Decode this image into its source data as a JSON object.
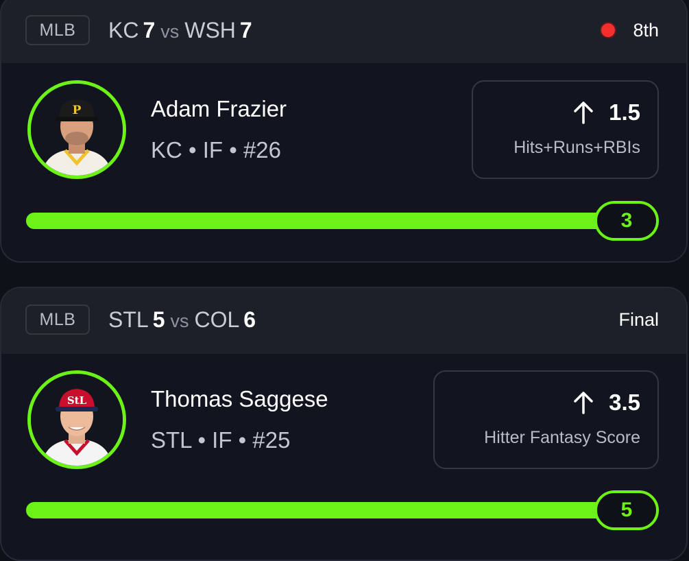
{
  "cards": [
    {
      "league": "MLB",
      "away_team": "KC",
      "away_score": "7",
      "vs": "vs",
      "home_team": "WSH",
      "home_score": "7",
      "status": "8th",
      "status_live": true,
      "player": {
        "name": "Adam Frazier",
        "meta": "KC • IF • #26",
        "avatar_icon": "player-headshot-pirates-cap"
      },
      "line": {
        "direction_icon": "arrow-up-icon",
        "value": "1.5",
        "stat": "Hits+Runs+RBIs"
      },
      "progress": {
        "current": "3",
        "fill_fraction": 1.0
      }
    },
    {
      "league": "MLB",
      "away_team": "STL",
      "away_score": "5",
      "vs": "vs",
      "home_team": "COL",
      "home_score": "6",
      "status": "Final",
      "status_live": false,
      "player": {
        "name": "Thomas Saggese",
        "meta": "STL • IF • #25",
        "avatar_icon": "player-headshot-cardinals-cap"
      },
      "line": {
        "direction_icon": "arrow-up-icon",
        "value": "3.5",
        "stat": "Hitter Fantasy Score"
      },
      "progress": {
        "current": "5",
        "fill_fraction": 1.0
      }
    }
  ],
  "colors": {
    "accent": "#6cf217",
    "live": "#f42d2d",
    "background": "#0f1119",
    "card": "#121520",
    "card_header": "#1d2029"
  }
}
